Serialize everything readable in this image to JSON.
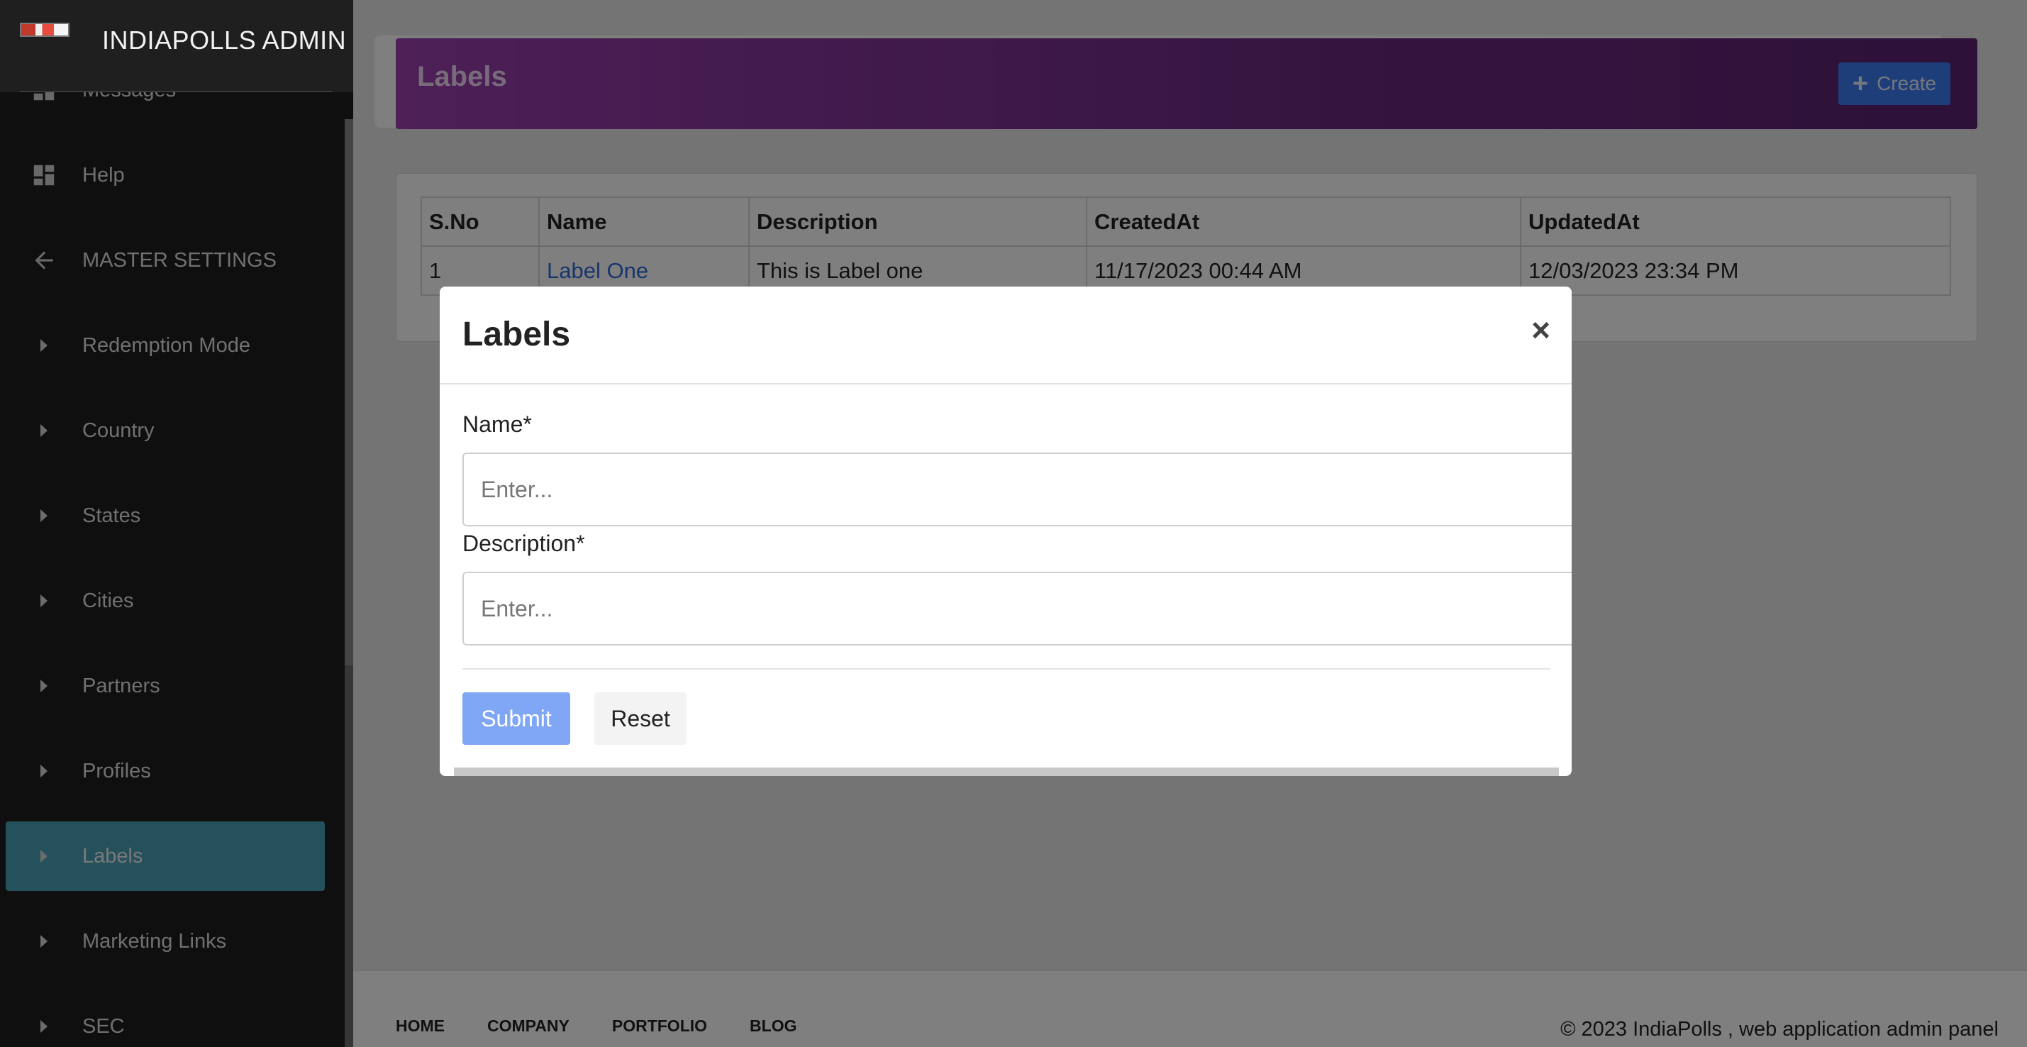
{
  "sidebar": {
    "brand_title": "INDIAPOLLS ADMIN",
    "items": [
      {
        "label": "Messages",
        "icon": "dashboard-icon"
      },
      {
        "label": "Help",
        "icon": "dashboard-icon"
      },
      {
        "label": "MASTER SETTINGS",
        "icon": "arrow-left-icon"
      },
      {
        "label": "Redemption Mode",
        "icon": "caret-right-icon"
      },
      {
        "label": "Country",
        "icon": "caret-right-icon"
      },
      {
        "label": "States",
        "icon": "caret-right-icon"
      },
      {
        "label": "Cities",
        "icon": "caret-right-icon"
      },
      {
        "label": "Partners",
        "icon": "caret-right-icon"
      },
      {
        "label": "Profiles",
        "icon": "caret-right-icon"
      },
      {
        "label": "Labels",
        "icon": "caret-right-icon",
        "active": true
      },
      {
        "label": "Marketing Links",
        "icon": "caret-right-icon"
      },
      {
        "label": "SEC",
        "icon": "caret-right-icon"
      }
    ]
  },
  "header": {
    "title": "Labels",
    "create_label": "Create"
  },
  "table": {
    "columns": [
      "S.No",
      "Name",
      "Description",
      "CreatedAt",
      "UpdatedAt"
    ],
    "rows": [
      {
        "sno": "1",
        "name": "Label One",
        "description": "This is Label one",
        "created": "11/17/2023 00:44 AM",
        "updated": "12/03/2023 23:34 PM"
      }
    ]
  },
  "footer": {
    "links": [
      "HOME",
      "COMPANY",
      "PORTFOLIO",
      "BLOG"
    ],
    "copyright": "© 2023 IndiaPolls , web application admin panel"
  },
  "modal": {
    "title": "Labels",
    "close": "×",
    "name_label": "Name*",
    "name_placeholder": "Enter...",
    "description_label": "Description*",
    "description_placeholder": "Enter...",
    "submit_label": "Submit",
    "reset_label": "Reset"
  },
  "colors": {
    "sidebar_bg": "#1f1f1f",
    "active_item": "#4aa3b8",
    "header_gradient_start": "#9c3fb0",
    "header_gradient_end": "#5b2272",
    "primary": "#3d7cf2",
    "link": "#2f6bd6"
  }
}
